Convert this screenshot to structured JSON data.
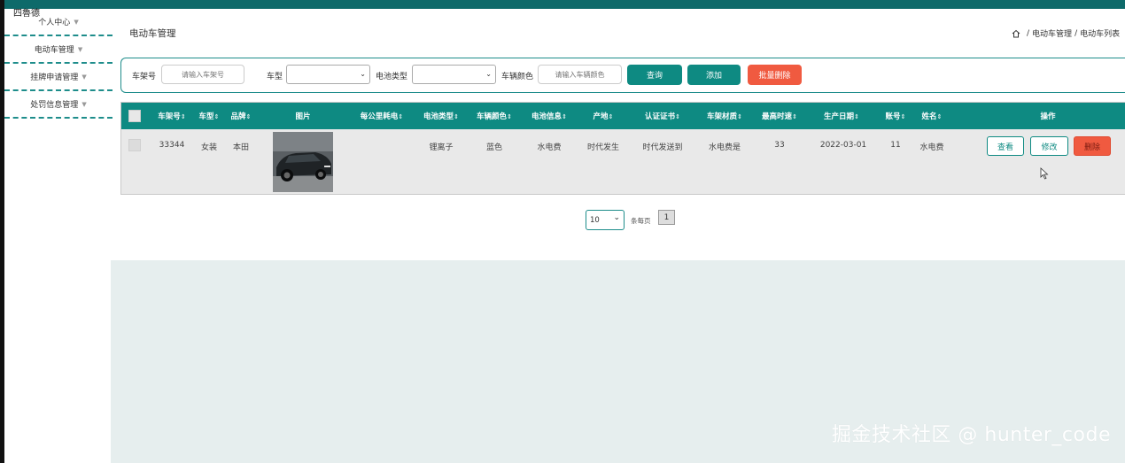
{
  "app": {
    "brand": "四魯德"
  },
  "sidebar": {
    "items": [
      {
        "label": "个人中心"
      },
      {
        "label": "电动车管理"
      },
      {
        "label": "挂牌申请管理"
      },
      {
        "label": "处罚信息管理"
      }
    ]
  },
  "header": {
    "title": "电动车管理",
    "breadcrumb": [
      "电动车管理",
      "电动车列表"
    ]
  },
  "search": {
    "frame_label": "车架号",
    "frame_placeholder": "请输入车架号",
    "type_label": "车型",
    "battery_label": "电池类型",
    "color_label": "车辆颜色",
    "color_placeholder": "请输入车辆颜色",
    "query_button": "查询",
    "add_button": "添加",
    "batch_delete_button": "批量删除"
  },
  "table": {
    "headers": [
      "车架号",
      "车型",
      "品牌",
      "图片",
      "每公里耗电",
      "电池类型",
      "车辆颜色",
      "电池信息",
      "产地",
      "认证证书",
      "车架材质",
      "最高时速",
      "生产日期",
      "账号",
      "姓名",
      "操作"
    ],
    "rows": [
      {
        "frame_no": "33344",
        "type": "女装",
        "brand": "本田",
        "power_per_km": "",
        "battery_type": "锂离子",
        "color": "蓝色",
        "battery_info": "水电费",
        "origin": "时代发生",
        "certificate": "时代发送到",
        "frame_material": "水电费是",
        "max_speed": "33",
        "production_date": "2022-03-01",
        "account": "11",
        "name": "水电费"
      }
    ],
    "actions": {
      "view": "查看",
      "edit": "修改",
      "delete": "删除"
    }
  },
  "pagination": {
    "page_size": "10",
    "per_page_label": "条每页",
    "current_page": "1"
  },
  "watermark": "掘金技术社区 @ hunter_code",
  "colors": {
    "primary": "#0e8a82",
    "danger": "#f05a40",
    "topbar": "#0e6a6a"
  }
}
